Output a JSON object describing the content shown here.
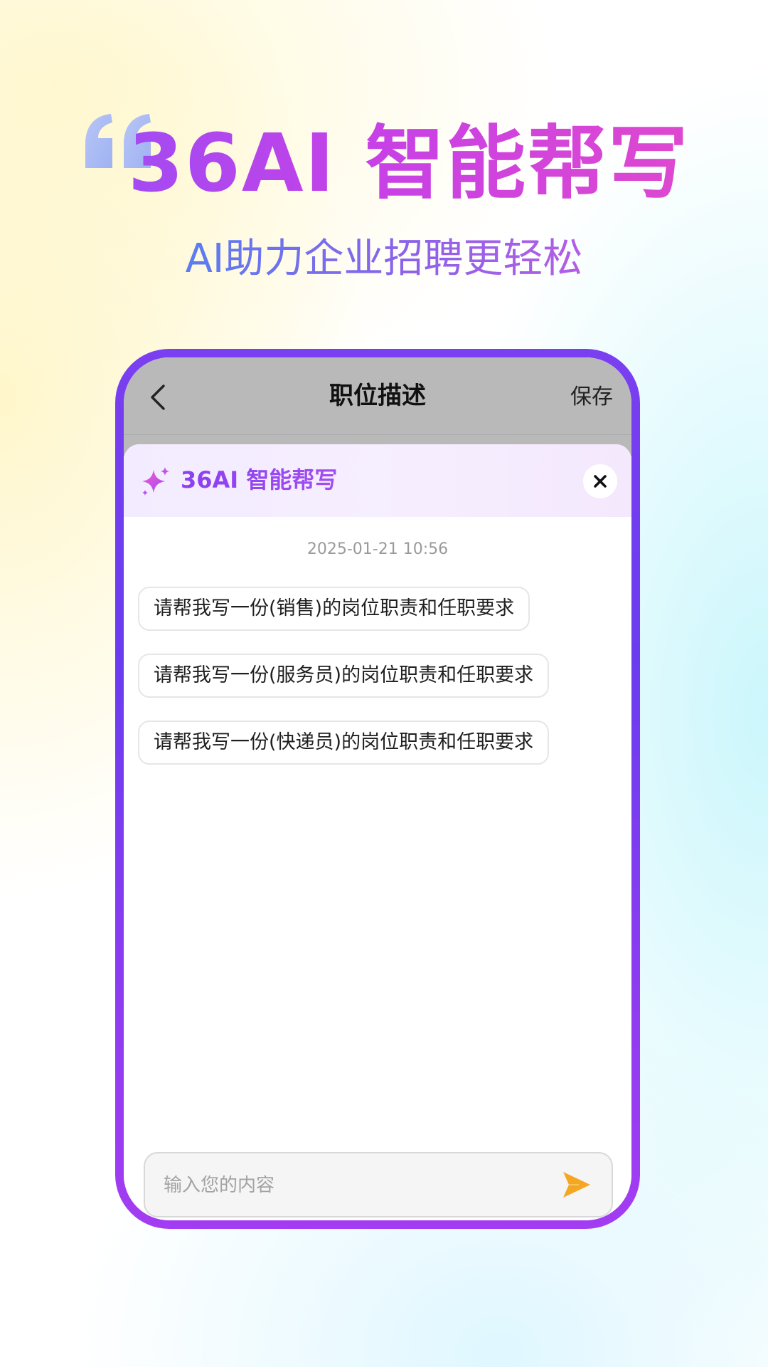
{
  "hero": {
    "title": "36AI 智能帮写",
    "subtitle": "AI助力企业招聘更轻松"
  },
  "nav": {
    "title": "职位描述",
    "save_label": "保存"
  },
  "ai_panel": {
    "title": "36AI 智能帮写",
    "timestamp": "2025-01-21 10:56",
    "suggestions": [
      "请帮我写一份(销售)的岗位职责和任职要求",
      "请帮我写一份(服务员)的岗位职责和任职要求",
      "请帮我写一份(快递员)的岗位职责和任职要求"
    ]
  },
  "input": {
    "value": "",
    "placeholder": "输入您的内容"
  },
  "icons": {
    "quote": "quote-mark-icon",
    "back": "chevron-left-icon",
    "sparkle": "sparkle-icon",
    "close": "close-icon",
    "send": "send-icon"
  },
  "colors": {
    "brand_purple": "#8b3ff0",
    "brand_pink": "#de48cf",
    "frame": "#7a3ff0",
    "send": "#f5a623"
  }
}
